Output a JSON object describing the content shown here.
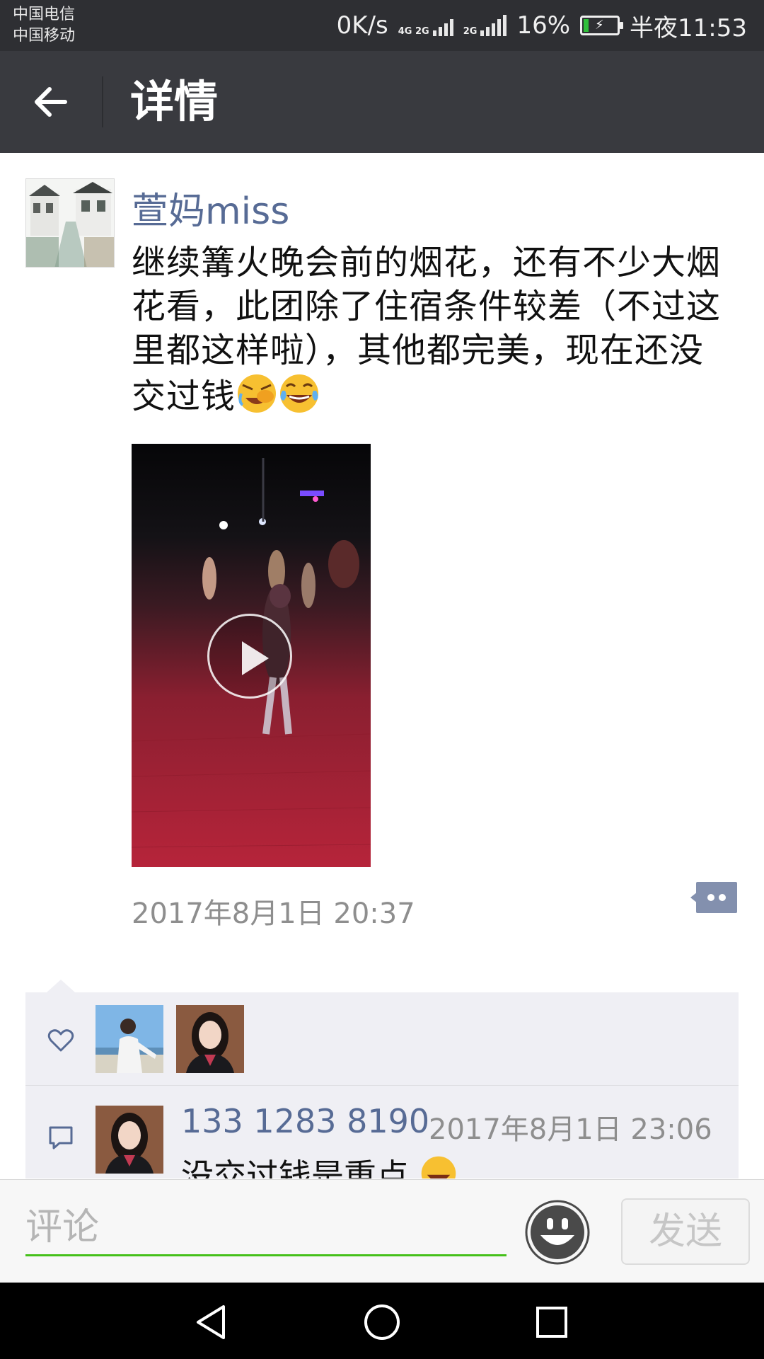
{
  "status_bar": {
    "carrier1": "中国电信",
    "carrier2": "中国移动",
    "speed": "0K/s",
    "net1": "4G 2G",
    "net2": "2G",
    "battery": "16%",
    "battery_level": 0.16,
    "time": "半夜11:53"
  },
  "header": {
    "title": "详情"
  },
  "post": {
    "author": "萱妈miss",
    "text": "继续篝火晚会前的烟花，还有不少大烟花看，此团除了住宿条件较差（不过这里都这样啦），其他都完美，现在还没交过钱",
    "time": "2017年8月1日 20:37"
  },
  "comment": {
    "name": "133 1283 8190",
    "time": "2017年8月1日 23:06",
    "text": "没交过钱是重点"
  },
  "input": {
    "placeholder": "评论"
  },
  "send_label": "发送",
  "colors": {
    "link": "#576b95",
    "accent_green": "#45c01a",
    "titlebar": "#393a3f"
  }
}
